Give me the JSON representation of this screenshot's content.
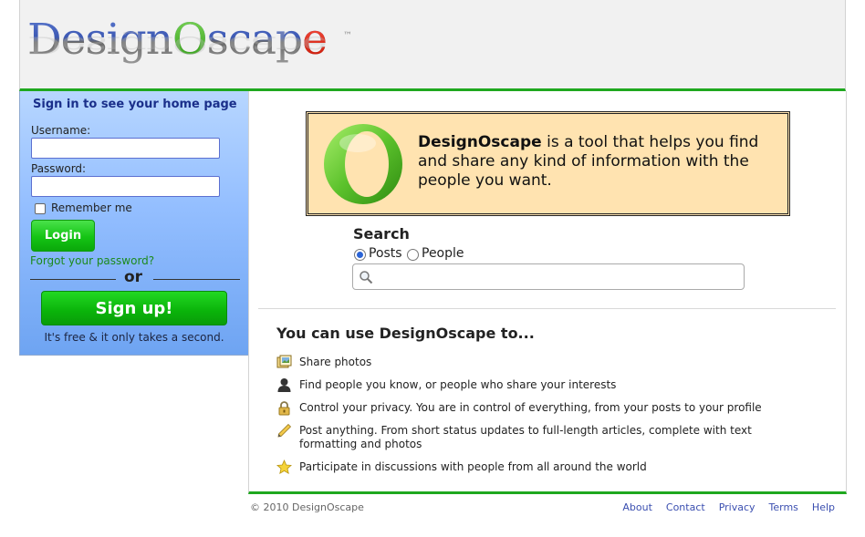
{
  "header": {
    "logo_text": "DesignOscape",
    "logo_trademark": "™"
  },
  "login": {
    "title": "Sign in to see your home page",
    "username_label": "Username:",
    "username_value": "",
    "password_label": "Password:",
    "password_value": "",
    "remember_label": "Remember me",
    "remember_checked": false,
    "login_button": "Login",
    "forgot_link": "Forgot your password?",
    "or_text": "or",
    "signup_button": "Sign up!",
    "signup_subtext": "It's free & it only takes a second."
  },
  "promo": {
    "brand": "DesignOscape",
    "text": " is a tool that helps you find and share any kind of information with the people you want."
  },
  "search": {
    "title": "Search",
    "options": [
      "Posts",
      "People"
    ],
    "selected": "Posts",
    "value": ""
  },
  "features": {
    "title": "You can use DesignOscape to...",
    "items": [
      {
        "icon": "photos-icon",
        "text": "Share photos"
      },
      {
        "icon": "person-icon",
        "text": "Find people you know, or people who share your interests"
      },
      {
        "icon": "lock-icon",
        "text": "Control your privacy. You are in control of everything, from your posts to your profile"
      },
      {
        "icon": "pencil-icon",
        "text": "Post anything. From short status updates to full-length articles, complete with text formatting and photos"
      },
      {
        "icon": "star-icon",
        "text": "Participate in discussions with people from all around the world"
      }
    ]
  },
  "footer": {
    "copyright": "© 2010 DesignOscape",
    "links": [
      "About",
      "Contact",
      "Privacy",
      "Terms",
      "Help"
    ]
  },
  "colors": {
    "accent_green": "#1fa81f",
    "sidebar_blue": "#93beff",
    "promo_bg": "#ffe3b0",
    "link_blue": "#3b4fb0"
  }
}
